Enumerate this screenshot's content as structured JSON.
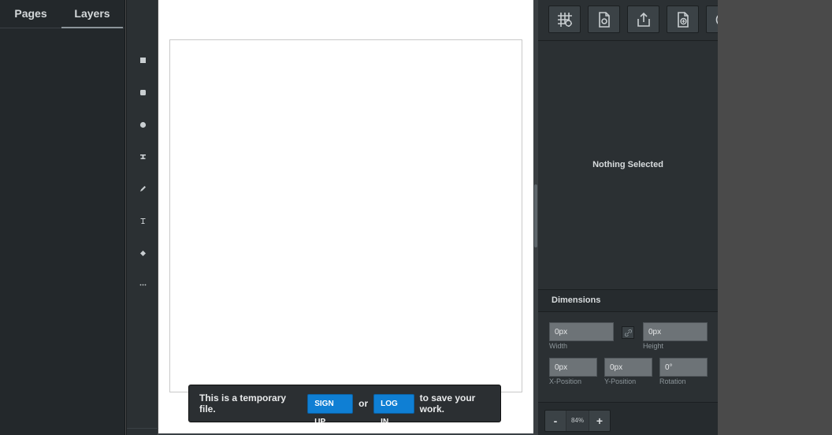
{
  "left_panel": {
    "tabs": [
      {
        "label": "Pages"
      },
      {
        "label": "Layers"
      }
    ]
  },
  "tool_rail": {
    "tools": [
      "rectangle-tool-icon",
      "rounded-rectangle-tool-icon",
      "ellipse-tool-icon",
      "stamp-tool-icon",
      "pen-tool-icon",
      "text-tool-icon",
      "paint-bucket-tool-icon",
      "more-tools-icon"
    ]
  },
  "toast": {
    "message_before": "This is a temporary file.",
    "signup_label": "SIGN UP",
    "or_label": "or",
    "login_label": "LOG IN",
    "message_after": "to save your work."
  },
  "right_panel": {
    "nothing_selected": "Nothing Selected",
    "dimensions": {
      "title": "Dimensions",
      "width": {
        "value": "0px",
        "label": "Width"
      },
      "height": {
        "value": "0px",
        "label": "Height"
      },
      "x": {
        "value": "0px",
        "label": "X-Position"
      },
      "y": {
        "value": "0px",
        "label": "Y-Position"
      },
      "rotation": {
        "value": "0°",
        "label": "Rotation"
      }
    },
    "zoom": {
      "minus": "-",
      "value": "84%",
      "plus": "+"
    }
  },
  "colors": {
    "accent": "#0f7fd4",
    "panel": "#2b3033"
  }
}
